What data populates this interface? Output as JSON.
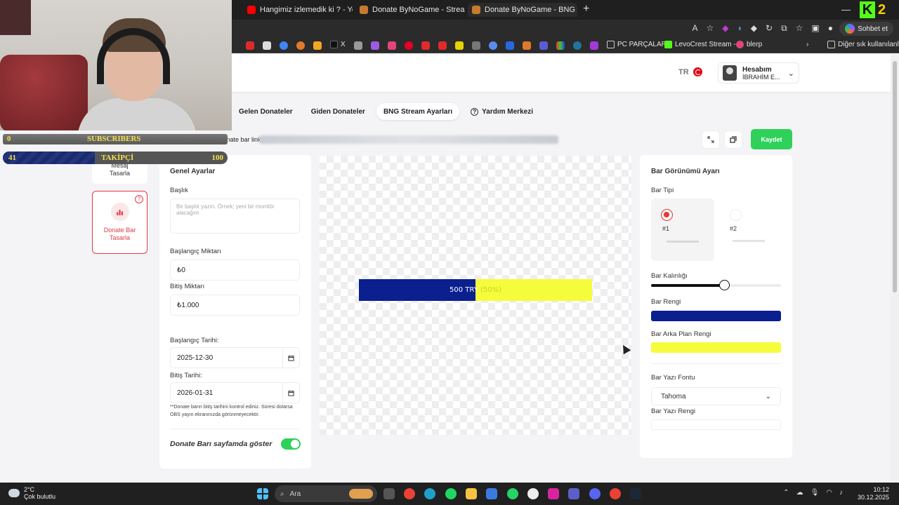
{
  "browser": {
    "tabs": [
      {
        "label": "Hangimiz izlemedik ki ? - YouTube",
        "icon_color": "#ff0000"
      },
      {
        "label": "Donate ByNoGame - Streamer Se",
        "icon_color": "#c77a2e"
      },
      {
        "label": "Donate ByNoGame - BNG Stream",
        "icon_color": "#c77a2e"
      }
    ],
    "close_glyph": "✕",
    "new_tab": "+",
    "chat_button": "Sohbet et",
    "bookmarks": {
      "pc_parts": "PC PARÇALARI",
      "levocrest": "LevoCrest Stream -...",
      "blerp": "blerp",
      "other": "Diğer sık kullanılanlar",
      "x_label": "X"
    }
  },
  "header": {
    "lang": "TR",
    "account_title": "Hesabım",
    "account_name": "İBRAHİM E..."
  },
  "nav": {
    "tabs": [
      "Gelen Donateler",
      "Giden Donateler",
      "BNG Stream Ayarları",
      "Yardım Merkezi"
    ],
    "active": "BNG Stream Ayarları"
  },
  "link_bar": {
    "label": "BNG Stream donate bar linki;",
    "save": "Kaydet"
  },
  "left_cards": {
    "message_design": "Mesaj\nTasarla",
    "donate_bar_design": "Donate Bar\nTasarla"
  },
  "general": {
    "title": "Genel Ayarlar",
    "heading_label": "Başlık",
    "heading_placeholder": "Bir başlık yazın. Örnek; yeni bir monitör alacağım",
    "start_amount_label": "Başlangıç Miktarı",
    "start_amount": "₺0",
    "end_amount_label": "Bitiş Miktarı",
    "end_amount": "₺1.000",
    "start_date_label": "Başlangıç Tarihi:",
    "start_date": "2025-12-30",
    "end_date_label": "Bitiş Tarihi:",
    "end_date": "2026-01-31",
    "note": "**Donate barın bitiş tarihini kontrol ediniz. Süresi dolarsa OBS yayın ekranınızda görünmeyecektir.",
    "show_label": "Donate Barı sayfamda göster",
    "show_enabled": true
  },
  "preview": {
    "amount_text": "500 TRY",
    "percent_text": "(50%)",
    "progress": 0.5,
    "fill_color": "#0b1f8f",
    "bg_color": "#f5fc3b"
  },
  "appearance": {
    "title": "Bar Görünümü Ayarı",
    "type_label": "Bar Tipi",
    "type_options": [
      "#1",
      "#2"
    ],
    "type_selected": "#1",
    "thickness_label": "Bar Kalınlığı",
    "thickness_level": 0.56,
    "color_label": "Bar Rengi",
    "color": "#0b1f8f",
    "bg_color_label": "Bar Arka Plan Rengi",
    "bg_color": "#f5fc3b",
    "font_label": "Bar Yazı Fontu",
    "font_value": "Tahoma",
    "text_color_label": "Bar Yazı Rengi"
  },
  "overlay": {
    "subs_current": "0",
    "subs_label": "SUBSCRIBERS",
    "followers_current": "41",
    "followers_label": "TAKİPÇİ",
    "followers_goal": "100",
    "followers_progress": 0.41
  },
  "taskbar": {
    "temp": "2°C",
    "weather": "Çok bulutlu",
    "search": "Ara",
    "time": "10:12",
    "date": "30.12.2025"
  }
}
